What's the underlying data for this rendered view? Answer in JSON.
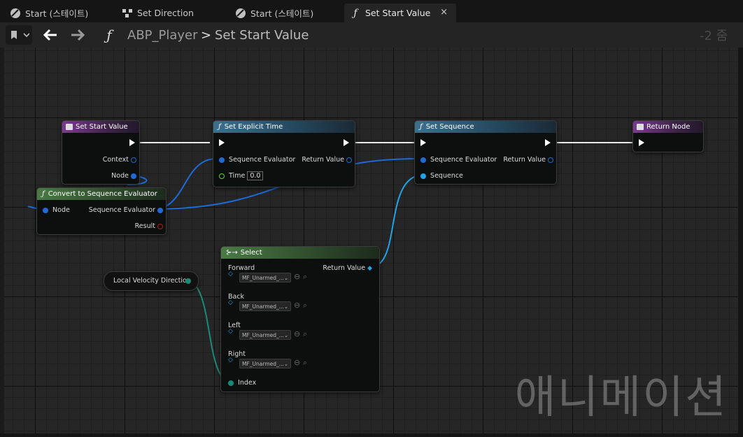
{
  "tabs": [
    {
      "label": "Start (스테이트)",
      "icon": "state-icon"
    },
    {
      "label": "Set Direction",
      "icon": "graph-icon"
    },
    {
      "label": "Start (스테이트)",
      "icon": "state-icon"
    },
    {
      "label": "Set Start Value",
      "icon": "function-icon",
      "active": true,
      "close": "×"
    }
  ],
  "toolbar": {
    "breadcrumb_root": "ABP_Player",
    "breadcrumb_sep": ">",
    "breadcrumb_current": "Set Start Value",
    "zoom": "-2 줌"
  },
  "nodes": {
    "set_start_value": {
      "title": "Set Start Value",
      "pins": {
        "context": "Context",
        "node": "Node"
      }
    },
    "convert": {
      "title": "Convert to Sequence Evaluator",
      "pins": {
        "node": "Node",
        "seq_eval": "Sequence Evaluator",
        "result": "Result"
      }
    },
    "set_explicit_time": {
      "title": "Set Explicit Time",
      "pins": {
        "seq_eval": "Sequence Evaluator",
        "return_value": "Return Value",
        "time": "Time",
        "time_value": "0.0"
      }
    },
    "set_sequence": {
      "title": "Set Sequence",
      "pins": {
        "seq_eval": "Sequence Evaluator",
        "return_value": "Return Value",
        "sequence": "Sequence"
      }
    },
    "return_node": {
      "title": "Return Node"
    },
    "select": {
      "title": "Select",
      "return_value": "Return Value",
      "options": [
        {
          "label": "Forward",
          "asset": "MF_Unarmed_..."
        },
        {
          "label": "Back",
          "asset": "MF_Unarmed_..."
        },
        {
          "label": "Left",
          "asset": "MF_Unarmed_..."
        },
        {
          "label": "Right",
          "asset": "MF_Unarmed_..."
        }
      ],
      "index": "Index"
    },
    "local_velocity": {
      "title": "Local Velocity Direction"
    }
  },
  "watermark": "애니메이션",
  "colors": {
    "purple": "#7a3b8e",
    "blue_header": "#3d6f8c",
    "green_header": "#4a7a45",
    "wire_blue": "#1e6ad8",
    "wire_teal": "#1a8a78",
    "exec": "#ffffff"
  }
}
